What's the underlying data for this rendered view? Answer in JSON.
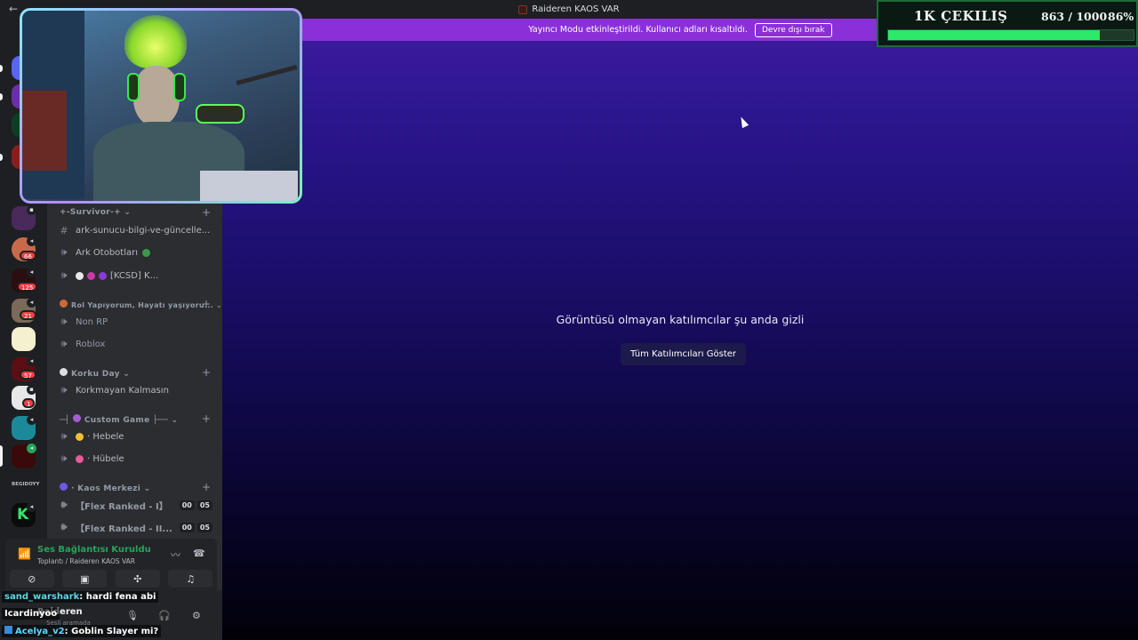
{
  "window": {
    "title": "Raideren KAOS VAR"
  },
  "banner": {
    "text": "Yayıncı Modu etkinleştirildi. Kullanıcı adları kısaltıldı.",
    "button": "Devre dışı bırak"
  },
  "rail": {
    "badges": [
      "66",
      "125",
      "21",
      "57",
      "1"
    ],
    "label_text": "BEGIDOYY"
  },
  "channels": {
    "categories": [
      {
        "name": "+-Survivor-+"
      },
      {
        "name": "Rol Yapıyorum, Hayatı yaşıyoru..."
      },
      {
        "name": "Korku Day"
      },
      {
        "name": "Custom Game"
      },
      {
        "name": "· Kaos Merkezi"
      }
    ],
    "items": [
      {
        "name": "ark-sunucu-bilgi-ve-güncelle..."
      },
      {
        "name": "Ark Otobotları"
      },
      {
        "name": "[KCSD]  K..."
      },
      {
        "name": "Non RP"
      },
      {
        "name": "Roblox"
      },
      {
        "name": "Korkmayan Kalmasın"
      },
      {
        "name": "· Hebele"
      },
      {
        "name": "· Hübele"
      },
      {
        "name": "【Flex Ranked - I】",
        "count": [
          "00",
          "05"
        ]
      },
      {
        "name": "【Flex Ranked - II...",
        "count": [
          "00",
          "05"
        ]
      }
    ]
  },
  "voice": {
    "title": "Ses Bağlantısı Kuruldu",
    "subtitle": "Toplantı / Raideren KAOS VAR"
  },
  "user": {
    "name": "Raideren",
    "status": "Sesli aramada"
  },
  "chat": [
    {
      "user": "sand_warshark",
      "message": ": hardi fena abi"
    },
    {
      "user": "Icardinyoo",
      "message": ""
    },
    {
      "user": "Acelya_v2",
      "message": ": Goblin Slayer mi?"
    }
  ],
  "stage": {
    "message": "Görüntüsü olmayan katılımcılar şu anda gizli",
    "button": "Tüm Katılımcıları Göster"
  },
  "giveaway": {
    "title": "1K ÇEKILIŞ",
    "count_text": "863 / 1000",
    "percent_text": "86%",
    "progress": 0.863
  },
  "colors": {
    "accent": "#8b30d8",
    "connected": "#23a55a",
    "progress": "#2ee86a",
    "badge": "#f23f43"
  }
}
